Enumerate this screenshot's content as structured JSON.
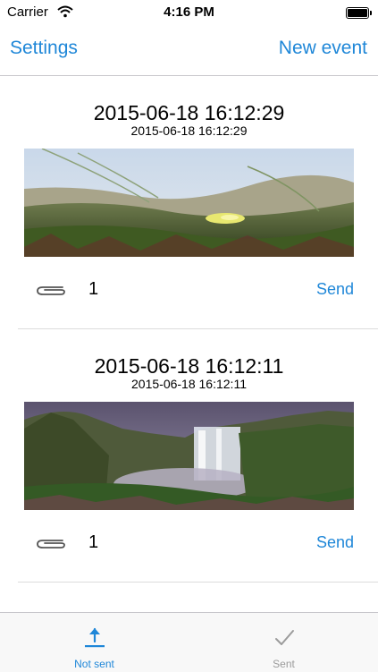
{
  "status": {
    "carrier": "Carrier",
    "time": "4:16 PM"
  },
  "nav": {
    "left_label": "Settings",
    "right_label": "New event"
  },
  "events": [
    {
      "title": "2015-06-18 16:12:29",
      "subtitle": "2015-06-18 16:12:29",
      "attachment_count": "1",
      "send_label": "Send"
    },
    {
      "title": "2015-06-18 16:12:11",
      "subtitle": "2015-06-18 16:12:11",
      "attachment_count": "1",
      "send_label": "Send"
    }
  ],
  "tabs": [
    {
      "label": "Not sent",
      "icon": "upload-icon",
      "color": "#1f87d8",
      "selected": true
    },
    {
      "label": "Sent",
      "icon": "checkmark-icon",
      "color": "#9b9b9b",
      "selected": false
    }
  ]
}
